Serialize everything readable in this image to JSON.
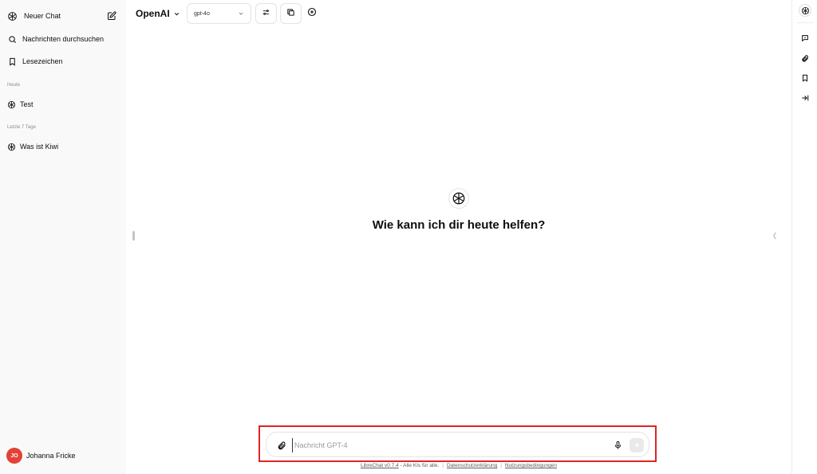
{
  "sidebar": {
    "new_chat_label": "Neuer Chat",
    "search_label": "Nachrichten durchsuchen",
    "bookmarks_label": "Lesezeichen",
    "sections": [
      {
        "title": "Heute",
        "items": [
          {
            "label": "Test"
          }
        ]
      },
      {
        "title": "Letzte 7 Tage",
        "items": [
          {
            "label": "Was ist Kiwi"
          }
        ]
      }
    ],
    "user": {
      "initials": "JO",
      "name": "Johanna Fricke"
    }
  },
  "header": {
    "endpoint": "OpenAI",
    "model": "gpt-4o"
  },
  "landing": {
    "title": "Wie kann ich dir heute helfen?"
  },
  "composer": {
    "placeholder": "Nachricht GPT-4",
    "value": ""
  },
  "footer": {
    "brand_link": "LibreChat v0.7.4",
    "tagline": " - Alle KIs für alle.",
    "privacy_link": "Datenschutzerklärung",
    "terms_link": "Nutzungsbedingungen"
  },
  "colors": {
    "sidebar_bg": "#f9f9f9",
    "avatar_bg": "#e34234",
    "highlight_border": "#e02424",
    "send_bg": "#e9e9e9"
  }
}
